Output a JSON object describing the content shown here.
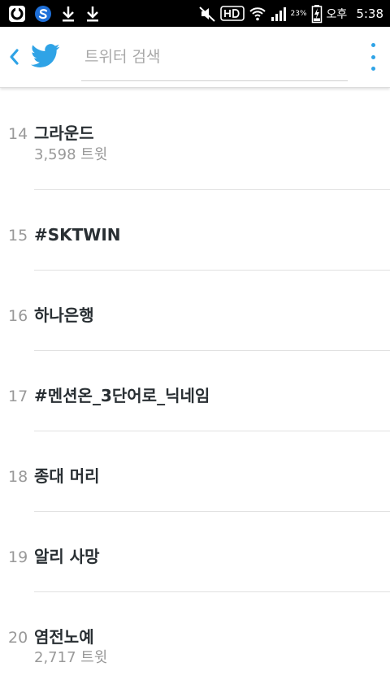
{
  "status_bar": {
    "left_icons": [
      "opera-icon",
      "samsung-s-icon",
      "download-icon",
      "download-icon"
    ],
    "right_icons": [
      "mute-icon",
      "hd-icon",
      "wifi-icon",
      "signal-icon",
      "battery-charging-icon"
    ],
    "battery_percent": "23%",
    "ampm": "오후",
    "time": "5:38"
  },
  "app_bar": {
    "back_icon": "chevron-left-icon",
    "logo_icon": "twitter-bird-icon",
    "search_placeholder": "트위터 검색",
    "search_value": "",
    "overflow_icon": "more-vertical-icon",
    "accent_color": "#2fa3e6"
  },
  "trends": [
    {
      "rank": "14",
      "name": "그라운드",
      "count": "3,598 트윗"
    },
    {
      "rank": "15",
      "name": "#SKTWIN"
    },
    {
      "rank": "16",
      "name": "하나은행"
    },
    {
      "rank": "17",
      "name": "#멘션온_3단어로_닉네임"
    },
    {
      "rank": "18",
      "name": "종대 머리"
    },
    {
      "rank": "19",
      "name": "알리 사망"
    },
    {
      "rank": "20",
      "name": "염전노예",
      "count": "2,717 트윗"
    }
  ]
}
